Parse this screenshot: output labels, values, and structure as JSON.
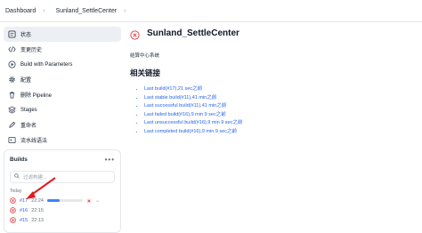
{
  "breadcrumb": {
    "items": [
      "Dashboard",
      "Sunland_SettleCenter"
    ]
  },
  "sidebar": {
    "items": [
      {
        "label": "状态",
        "icon": "status-icon",
        "active": true
      },
      {
        "label": "变更历史",
        "icon": "code-icon"
      },
      {
        "label": "Build with Parameters",
        "icon": "play-icon"
      },
      {
        "label": "配置",
        "icon": "gear-icon"
      },
      {
        "label": "删除 Pipeline",
        "icon": "trash-icon"
      },
      {
        "label": "Stages",
        "icon": "stages-icon"
      },
      {
        "label": "重命名",
        "icon": "pencil-icon"
      },
      {
        "label": "流水线语法",
        "icon": "help-icon"
      }
    ]
  },
  "builds": {
    "title": "Builds",
    "filter_placeholder": "过滤构建...",
    "group": "Today",
    "rows": [
      {
        "number": "#17",
        "time": "22:24",
        "progress": 0.35,
        "running": true
      },
      {
        "number": "#16",
        "time": "22:15"
      },
      {
        "number": "#15",
        "time": "22:13"
      }
    ]
  },
  "main": {
    "title": "Sunland_SettleCenter",
    "description": "结算中心系统",
    "links_heading": "相关链接",
    "links": [
      "Last build(#17),21 sec之前",
      "Last stable build(#11),41 min之前",
      "Last successful build(#11),41 min之前",
      "Last failed build(#16),9 min 9 sec之前",
      "Last unsuccessful build(#16),9 min 9 sec之前",
      "Last completed build(#16),9 min 9 sec之前"
    ]
  },
  "colors": {
    "failed": "#e5484d",
    "link": "#2563eb",
    "progress": "#3b82f6",
    "annotation_arrow": "#e11d1d"
  }
}
